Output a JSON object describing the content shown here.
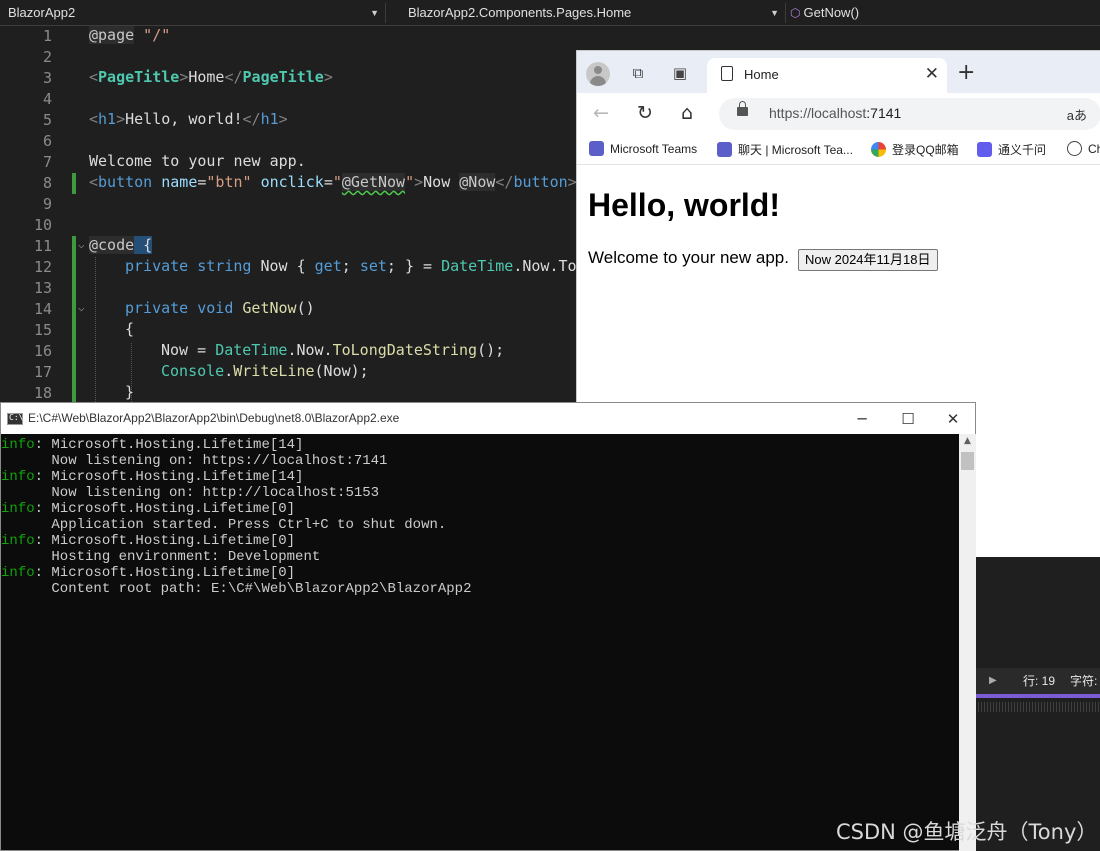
{
  "vs": {
    "nav": {
      "project": "BlazorApp2",
      "class": "BlazorApp2.Components.Pages.Home",
      "member": "GetNow()"
    },
    "line_numbers": [
      "1",
      "2",
      "3",
      "4",
      "5",
      "6",
      "7",
      "8",
      "9",
      "10",
      "11",
      "12",
      "13",
      "14",
      "15",
      "16",
      "17",
      "18"
    ],
    "code": {
      "l1_kw": "@page",
      "l1_str": " \"/\"",
      "l3_open": "<",
      "l3_tag": "PageTitle",
      "l3_close": ">",
      "l3_text": "Home",
      "l3_end_open": "</",
      "l3_end_tag": "PageTitle",
      "l3_end_close": ">",
      "l5_open": "<",
      "l5_tag": "h1",
      "l5_close": ">",
      "l5_text": "Hello, world!",
      "l5_end_open": "</",
      "l5_end_tag": "h1",
      "l5_end_close": ">",
      "l7_text": "Welcome to your new app.",
      "l8_open": "<",
      "l8_tag": "button",
      "l8_attr1": " name",
      "l8_eq1": "=",
      "l8_val1": "\"btn\"",
      "l8_attr2": " onclick",
      "l8_eq2": "=",
      "l8_q1": "\"",
      "l8_handler": "@GetNow",
      "l8_q2": "\"",
      "l8_close": ">",
      "l8_text": "Now ",
      "l8_razor": "@Now",
      "l8_end_open": "</",
      "l8_end_tag": "button",
      "l8_end_close": ">",
      "l11_kw": "@code",
      "l11_brace": " {",
      "l12_kw1": "private",
      "l12_kw2": " string",
      "l12_name": " Now { ",
      "l12_get": "get",
      "l12_semi1": "; ",
      "l12_set": "set",
      "l12_rest": "; } = ",
      "l12_type": "DateTime",
      "l12_tail": ".Now.To",
      "l14_kw1": "private",
      "l14_kw2": " void",
      "l14_meth": " GetNow",
      "l14_paren": "()",
      "l15_brace": "{",
      "l16_a": "Now = ",
      "l16_type": "DateTime",
      "l16_b": ".Now.",
      "l16_meth": "ToLongDateString",
      "l16_c": "();",
      "l17_type": "Console",
      "l17_b": ".",
      "l17_meth": "WriteLine",
      "l17_c": "(Now);",
      "l18_brace": "}"
    },
    "status": {
      "line": "行: 19",
      "char": "字符:"
    }
  },
  "browser": {
    "tab_title": "Home",
    "url_host": "https://localhost",
    "url_port": ":7141",
    "read_aloud": "aあ",
    "favorites": [
      {
        "label": "Microsoft Teams",
        "color": "#5b5fc7"
      },
      {
        "label": "聊天 | Microsoft Tea...",
        "color": "#5b5fc7"
      },
      {
        "label": "登录QQ邮箱",
        "color": "#f4b400"
      },
      {
        "label": "通义千问",
        "color": "#615ced"
      },
      {
        "label": "Ch",
        "color": "#444444"
      }
    ],
    "page": {
      "heading": "Hello, world!",
      "welcome": "Welcome to your new app.",
      "button_label": "Now 2024年11月18日"
    }
  },
  "console": {
    "title": "E:\\C#\\Web\\BlazorApp2\\BlazorApp2\\bin\\Debug\\net8.0\\BlazorApp2.exe",
    "icon_text": "C:\\",
    "lines": [
      {
        "prefix": "info",
        "text": ": Microsoft.Hosting.Lifetime[14]"
      },
      {
        "prefix": "",
        "text": "      Now listening on: https://localhost:7141"
      },
      {
        "prefix": "info",
        "text": ": Microsoft.Hosting.Lifetime[14]"
      },
      {
        "prefix": "",
        "text": "      Now listening on: http://localhost:5153"
      },
      {
        "prefix": "info",
        "text": ": Microsoft.Hosting.Lifetime[0]"
      },
      {
        "prefix": "",
        "text": "      Application started. Press Ctrl+C to shut down."
      },
      {
        "prefix": "info",
        "text": ": Microsoft.Hosting.Lifetime[0]"
      },
      {
        "prefix": "",
        "text": "      Hosting environment: Development"
      },
      {
        "prefix": "info",
        "text": ": Microsoft.Hosting.Lifetime[0]"
      },
      {
        "prefix": "",
        "text": "      Content root path: E:\\C#\\Web\\BlazorApp2\\BlazorApp2"
      }
    ]
  },
  "watermark": "CSDN @鱼塘泛舟（Tony）"
}
